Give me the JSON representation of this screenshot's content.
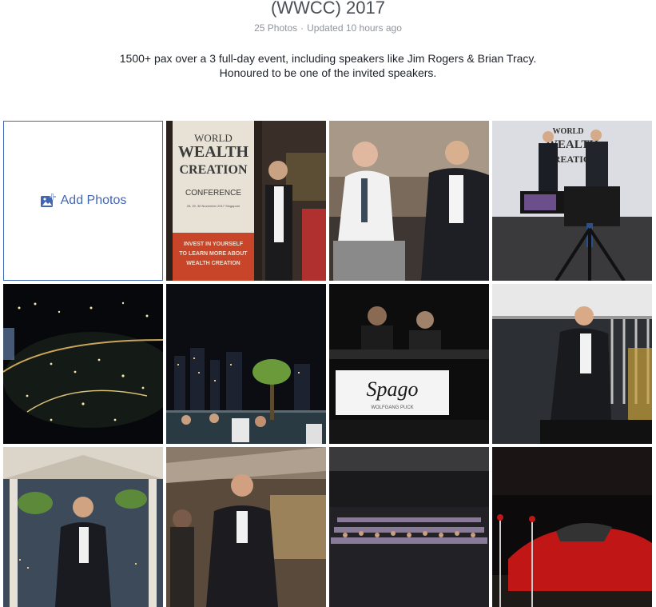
{
  "album": {
    "title": "(WWCC) 2017",
    "photo_count": "25 Photos",
    "separator": "·",
    "updated": "Updated 10 hours ago",
    "description_line1": "1500+ pax over a 3 full-day event, including speakers like Jim Rogers & Brian Tracy.",
    "description_line2": "Honoured to be one of the invited speakers."
  },
  "add_photos": {
    "label": "Add Photos",
    "icon": "add-photo-icon",
    "color": "#4267b2"
  },
  "photos": {
    "banner": {
      "line1": "WORLD",
      "line2": "WEALTH",
      "line3": "CREATION",
      "line4": "CONFERENCE",
      "dates": "28, 29, 30 November 2017 Singapore",
      "tag1": "INVEST IN YOURSELF",
      "tag2": "TO LEARN MORE ABOUT",
      "tag3": "WEALTH CREATION"
    },
    "stage": {
      "line1": "WORLD",
      "line2": "WEALTH",
      "line3": "CREATION"
    },
    "spago": {
      "logo": "Spago",
      "sub": "WOLFGANG PUCK"
    }
  }
}
